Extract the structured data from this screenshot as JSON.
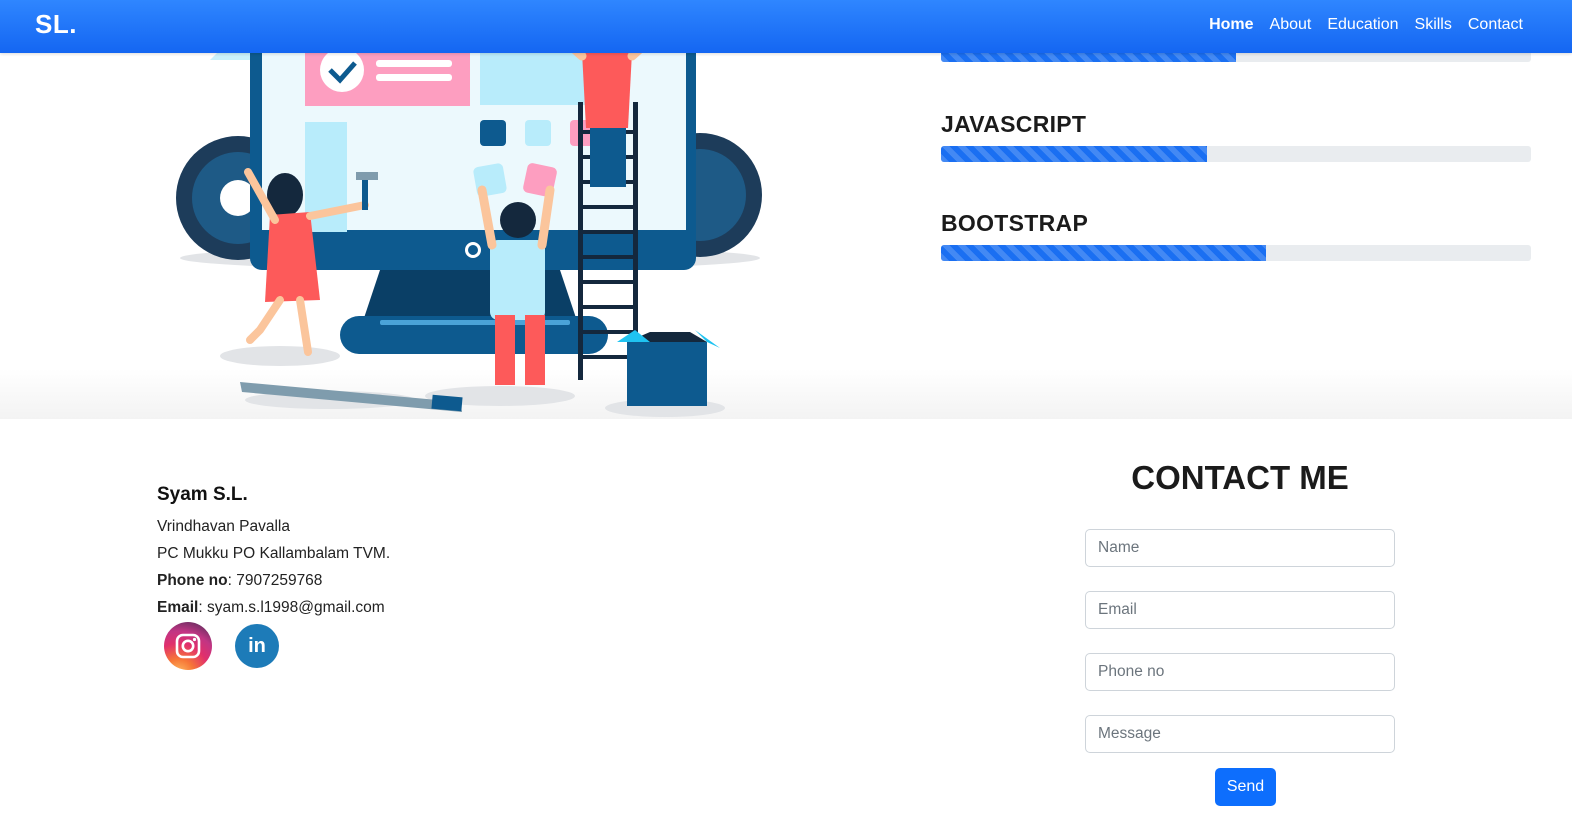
{
  "navbar": {
    "brand": "SL.",
    "links": [
      {
        "label": "Home",
        "active": true
      },
      {
        "label": "About",
        "active": false
      },
      {
        "label": "Education",
        "active": false
      },
      {
        "label": "Skills",
        "active": false
      },
      {
        "label": "Contact",
        "active": false
      }
    ]
  },
  "skills": [
    {
      "name": "",
      "progress": 0.5
    },
    {
      "name": "JAVASCRIPT",
      "progress": 0.45
    },
    {
      "name": "BOOTSTRAP",
      "progress": 0.55
    }
  ],
  "contact": {
    "name": "Syam S.L.",
    "address_line1": "Vrindhavan Pavalla",
    "address_line2": "PC Mukku PO Kallambalam TVM.",
    "phone_label": "Phone no",
    "phone_value": ": 7907259768",
    "email_label": "Email",
    "email_value": ": syam.s.l1998@gmail.com",
    "social": [
      "instagram-icon",
      "linkedin-icon"
    ],
    "linkedin_text": "in"
  },
  "form": {
    "title": "CONTACT ME",
    "name_placeholder": "Name",
    "email_placeholder": "Email",
    "phone_placeholder": "Phone no",
    "message_placeholder": "Message",
    "send_label": "Send"
  },
  "colors": {
    "navbar": "#1a6ff2",
    "accent": "#0d6efd",
    "progress_track": "#e9ecef"
  }
}
